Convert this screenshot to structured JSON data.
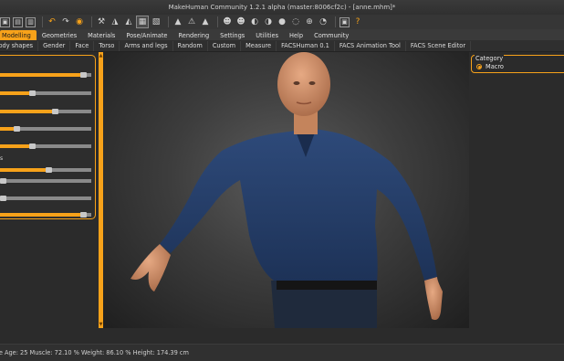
{
  "window": {
    "title": "MakeHuman Community 1.2.1 alpha (master:8006cf2c) - [anne.mhm]*"
  },
  "toolbar": {
    "tools": [
      {
        "icon": "folder-save-icon"
      },
      {
        "icon": "folder-open-icon"
      },
      {
        "icon": "export-icon"
      },
      {
        "icon": "undo-icon"
      },
      {
        "icon": "redo-icon"
      },
      {
        "icon": "reset-icon"
      },
      {
        "icon": "wireframe-icon"
      },
      {
        "icon": "smooth-icon"
      },
      {
        "icon": "subdivide-icon"
      },
      {
        "icon": "grid-icon"
      },
      {
        "icon": "pose-icon"
      },
      {
        "icon": "skeleton-icon"
      },
      {
        "icon": "background-icon"
      },
      {
        "icon": "front-view-icon"
      },
      {
        "icon": "back-view-icon"
      },
      {
        "icon": "left-view-icon"
      },
      {
        "icon": "right-view-icon"
      },
      {
        "icon": "top-view-icon"
      },
      {
        "icon": "bottom-view-icon"
      },
      {
        "icon": "reset-camera-icon"
      },
      {
        "icon": "screenshot-icon"
      },
      {
        "icon": "help-icon"
      }
    ]
  },
  "menu": {
    "tabs": [
      "Modelling",
      "Geometries",
      "Materials",
      "Pose/Animate",
      "Rendering",
      "Settings",
      "Utilities",
      "Help",
      "Community"
    ],
    "active": "Modelling"
  },
  "subtabs": [
    "Body shapes",
    "Gender",
    "Face",
    "Torso",
    "Arms and legs",
    "Random",
    "Custom",
    "Measure",
    "FACSHuman 0.1",
    "FACS Animation Tool",
    "FACS Scene Editor"
  ],
  "left_panel": {
    "sliders": [
      {
        "label": "",
        "value": 0.91
      },
      {
        "label": "",
        "value": 0.35
      },
      {
        "label": "",
        "value": 0.6
      },
      {
        "label": "",
        "value": 0.18
      },
      {
        "label": "",
        "value": 0.35
      },
      {
        "label": "s",
        "value": 0.53
      },
      {
        "label": "",
        "value": 0.0
      },
      {
        "label": "",
        "value": 0.0
      },
      {
        "label": "",
        "value": 0.91
      }
    ]
  },
  "right_panel": {
    "category_title": "Category",
    "options": [
      {
        "label": "Macro",
        "selected": true
      }
    ]
  },
  "status": {
    "text": "le Age: 25 Muscle: 72.10 % Weight: 86.10 % Height: 174.39 cm"
  },
  "colors": {
    "accent": "#f7a21a",
    "background": "#2b2b2b"
  }
}
